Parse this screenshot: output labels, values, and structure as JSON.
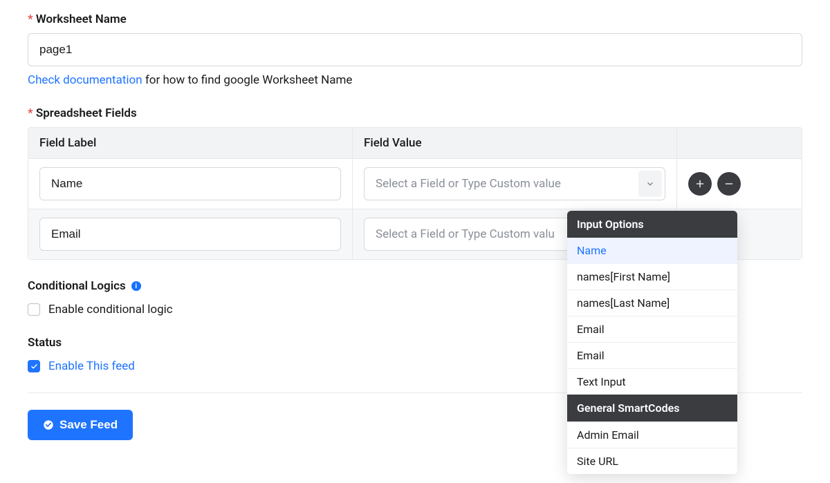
{
  "worksheet": {
    "label": "Worksheet Name",
    "value": "page1",
    "doc_link": "Check documentation",
    "doc_tail": " for how to find google Worksheet Name"
  },
  "fields_section": {
    "label": "Spreadsheet Fields",
    "col_label": "Field Label",
    "col_value": "Field Value",
    "rows": [
      {
        "label": "Name",
        "placeholder": "Select a Field or Type Custom value"
      },
      {
        "label": "Email",
        "placeholder": "Select a Field or Type Custom valu"
      }
    ]
  },
  "conditional": {
    "title": "Conditional Logics",
    "checkbox_label": "Enable conditional logic",
    "checked": false
  },
  "status": {
    "title": "Status",
    "checkbox_label": "Enable This feed",
    "checked": true
  },
  "save_button": "Save Feed",
  "dropdown": {
    "group1": "Input Options",
    "items1": [
      "Name",
      "names[First Name]",
      "names[Last Name]",
      "Email",
      "Email",
      "Text Input"
    ],
    "group2": "General SmartCodes",
    "items2": [
      "Admin Email",
      "Site URL"
    ]
  }
}
